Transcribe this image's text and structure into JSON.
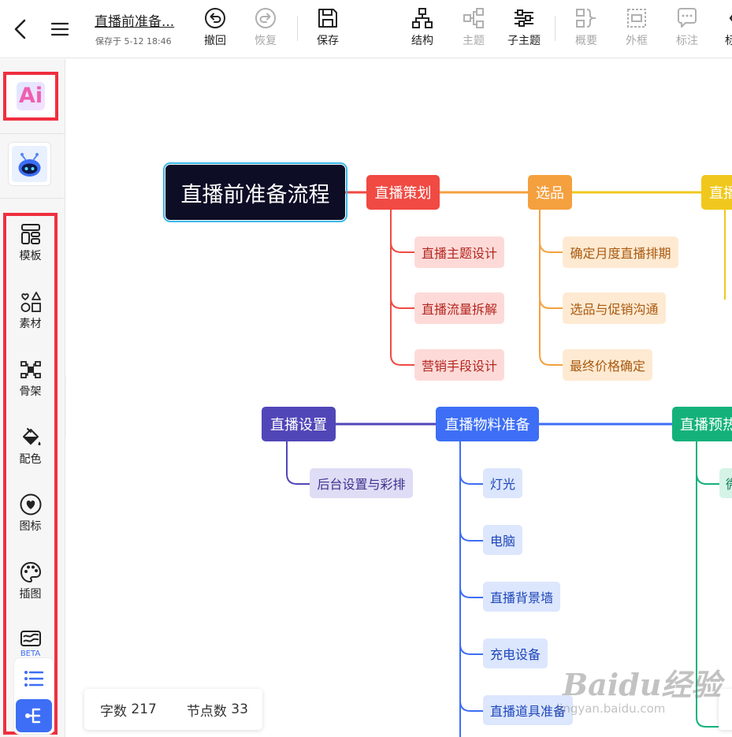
{
  "header": {
    "doc_title": "直播前准备...",
    "save_status": "保存于 5-12 18:46",
    "tools": [
      {
        "label": "撤回",
        "icon": "undo-icon",
        "disabled": false
      },
      {
        "label": "恢复",
        "icon": "redo-icon",
        "disabled": true
      },
      {
        "label": "保存",
        "icon": "save-icon",
        "disabled": false
      },
      {
        "label": "结构",
        "icon": "structure-icon",
        "disabled": false
      },
      {
        "label": "主题",
        "icon": "topic-icon",
        "disabled": true
      },
      {
        "label": "子主题",
        "icon": "subtopic-icon",
        "disabled": false
      },
      {
        "label": "概要",
        "icon": "summary-icon",
        "disabled": true
      },
      {
        "label": "外框",
        "icon": "frame-icon",
        "disabled": true
      },
      {
        "label": "标注",
        "icon": "callout-icon",
        "disabled": true
      },
      {
        "label": "标",
        "icon": "tag-icon",
        "disabled": false
      }
    ]
  },
  "sidebar": {
    "ai_label": "Ai",
    "items": [
      {
        "label": "模板",
        "icon": "template-icon"
      },
      {
        "label": "素材",
        "icon": "material-icon"
      },
      {
        "label": "骨架",
        "icon": "skeleton-icon"
      },
      {
        "label": "配色",
        "icon": "paint-bucket-icon"
      },
      {
        "label": "图标",
        "icon": "heart-icon"
      },
      {
        "label": "插图",
        "icon": "palette-icon"
      },
      {
        "label": "",
        "icon": "image-icon"
      }
    ],
    "beta_label": "BETA"
  },
  "mindmap": {
    "root": "直播前准备流程",
    "branches": [
      {
        "title": "直播策划",
        "color": "#f04a43",
        "children": [
          "直播主题设计",
          "直播流量拆解",
          "营销手段设计"
        ]
      },
      {
        "title": "选品",
        "color": "#f5a03e",
        "children": [
          "确定月度直播排期",
          "选品与促销沟通",
          "最终价格确定"
        ]
      },
      {
        "title": "直播",
        "color": "#f0c81d",
        "children": []
      },
      {
        "title": "直播设置",
        "color": "#5146b8",
        "children": [
          "后台设置与彩排"
        ]
      },
      {
        "title": "直播物料准备",
        "color": "#3d6ef5",
        "children": [
          "灯光",
          "电脑",
          "直播背景墙",
          "充电设备",
          "直播道具准备"
        ]
      },
      {
        "title": "直播预热",
        "color": "#14b27a",
        "children": [
          "微"
        ]
      }
    ]
  },
  "stats": {
    "word_label": "字数",
    "word_count": "217",
    "node_label": "节点数",
    "node_count": "33"
  },
  "watermark": {
    "main": "Baidu经验",
    "sub": "jingyan.baidu.com"
  }
}
